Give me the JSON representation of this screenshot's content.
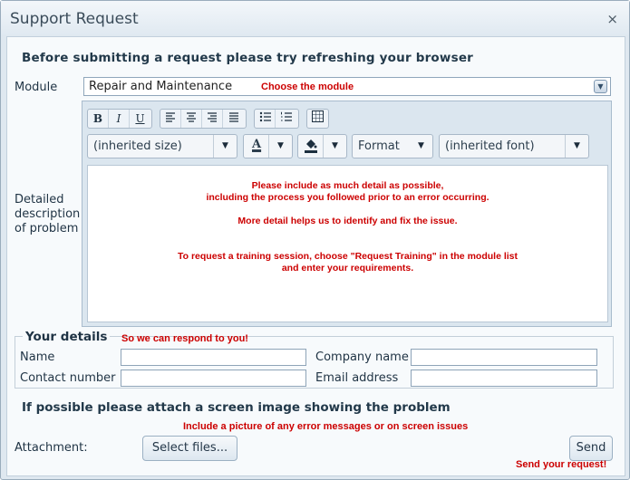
{
  "window": {
    "title": "Support Request",
    "close_icon": "×"
  },
  "heading": "Before submitting a request please try refreshing your browser",
  "module": {
    "label": "Module",
    "value": "Repair and Maintenance",
    "hint": "Choose the module",
    "arrow_icon": "▼"
  },
  "editor": {
    "toolbar": {
      "bold": "B",
      "italic": "I",
      "underline": "U",
      "size_value": "(inherited size)",
      "format_value": "Format",
      "font_value": "(inherited font)",
      "font_color_glyph": "A",
      "dropdown_arrow": "▼"
    },
    "lines": [
      "Please include as much detail as possible,",
      "including the process you followed prior to an error occurring.",
      "More detail helps us to identify and fix the issue.",
      "To request a training session, choose \"Request Training\" in the module list",
      "and enter your requirements."
    ]
  },
  "description_label": [
    "Detailed",
    "description",
    "of problem"
  ],
  "details": {
    "legend": "Your details",
    "hint": "So we can respond to you!",
    "name_label": "Name",
    "company_label": "Company name",
    "contact_label": "Contact number",
    "email_label": "Email address",
    "name_value": "",
    "company_value": "",
    "contact_value": "",
    "email_value": ""
  },
  "attachment": {
    "heading": "If possible please attach a screen image showing the problem",
    "hint": "Include a picture of any error messages or on screen issues",
    "label": "Attachment:",
    "select_button": "Select files..."
  },
  "send": {
    "button": "Send",
    "hint": "Send your request!"
  },
  "colors": {
    "hint_red": "#cc0000",
    "panel_bg": "#f7fafc",
    "window_bg": "#dfe8f0"
  }
}
